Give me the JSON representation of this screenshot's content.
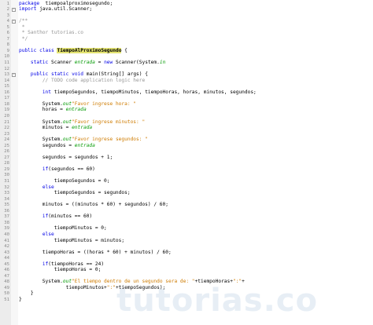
{
  "lines": [
    {
      "n": "1",
      "parts": [
        [
          "kw",
          "package"
        ],
        [
          "",
          "  tiempoalproximosegundo;"
        ]
      ]
    },
    {
      "n": "2",
      "fold": "-",
      "parts": [
        [
          "kw",
          "import"
        ],
        [
          "",
          " java.util.Scanner;"
        ]
      ]
    },
    {
      "n": "3",
      "parts": []
    },
    {
      "n": "4",
      "fold": "-",
      "parts": [
        [
          "com",
          "/**"
        ]
      ]
    },
    {
      "n": "5",
      "parts": [
        [
          "com",
          " *"
        ]
      ]
    },
    {
      "n": "6",
      "parts": [
        [
          "com",
          " * Santhor tutorias.co"
        ]
      ]
    },
    {
      "n": "7",
      "parts": [
        [
          "com",
          " */"
        ]
      ]
    },
    {
      "n": "8",
      "parts": []
    },
    {
      "n": "9",
      "parts": [
        [
          "kw",
          "public"
        ],
        [
          "",
          " "
        ],
        [
          "kw",
          "class"
        ],
        [
          "",
          " "
        ],
        [
          "cls",
          "TiempoAlProximoSegundo"
        ],
        [
          "",
          " {"
        ]
      ]
    },
    {
      "n": "10",
      "parts": []
    },
    {
      "n": "11",
      "parts": [
        [
          "",
          "    "
        ],
        [
          "kw",
          "static"
        ],
        [
          "",
          " Scanner "
        ],
        [
          "fld",
          "entrada"
        ],
        [
          "",
          " = "
        ],
        [
          "kw",
          "new"
        ],
        [
          "",
          " Scanner(System."
        ],
        [
          "fld",
          "in"
        ],
        [
          ");"
        ]
      ]
    },
    {
      "n": "12",
      "parts": []
    },
    {
      "n": "13",
      "fold": "-",
      "parts": [
        [
          "",
          "    "
        ],
        [
          "kw",
          "public"
        ],
        [
          "",
          " "
        ],
        [
          "kw",
          "static"
        ],
        [
          "",
          " "
        ],
        [
          "kw",
          "void"
        ],
        [
          "",
          " main(String[] args) {"
        ]
      ]
    },
    {
      "n": "14",
      "parts": [
        [
          "",
          "        "
        ],
        [
          "com",
          "// TODO code application logic here"
        ]
      ]
    },
    {
      "n": "15",
      "parts": []
    },
    {
      "n": "16",
      "parts": [
        [
          "",
          "        "
        ],
        [
          "kw",
          "int"
        ],
        [
          "",
          " tiempoSegundos, tiempoMinutos, tiempoHoras, horas, minutos, segundos;"
        ]
      ]
    },
    {
      "n": "17",
      "parts": []
    },
    {
      "n": "18",
      "parts": [
        [
          "",
          "        System."
        ],
        [
          "fld",
          "out"
        ],
        [
          ".print("
        ],
        [
          "str",
          "\"Favor ingrese hora: \""
        ],
        [
          ");"
        ]
      ]
    },
    {
      "n": "19",
      "parts": [
        [
          "",
          "        horas = "
        ],
        [
          "fld",
          "entrada"
        ],
        [
          ".nextInt();"
        ]
      ]
    },
    {
      "n": "20",
      "parts": []
    },
    {
      "n": "21",
      "parts": [
        [
          "",
          "        System."
        ],
        [
          "fld",
          "out"
        ],
        [
          ".print("
        ],
        [
          "str",
          "\"Favor ingrese minutos: \""
        ],
        [
          ");"
        ]
      ]
    },
    {
      "n": "22",
      "parts": [
        [
          "",
          "        minutos = "
        ],
        [
          "fld",
          "entrada"
        ],
        [
          ".nextInt();"
        ]
      ]
    },
    {
      "n": "23",
      "parts": []
    },
    {
      "n": "24",
      "parts": [
        [
          "",
          "        System."
        ],
        [
          "fld",
          "out"
        ],
        [
          ".print("
        ],
        [
          "str",
          "\"Favor ingrese segundos: \""
        ],
        [
          ");"
        ]
      ]
    },
    {
      "n": "25",
      "parts": [
        [
          "",
          "        segundos = "
        ],
        [
          "fld",
          "entrada"
        ],
        [
          ".nextInt();"
        ]
      ]
    },
    {
      "n": "26",
      "parts": []
    },
    {
      "n": "27",
      "parts": [
        [
          "",
          "        segundos = segundos + 1;"
        ]
      ]
    },
    {
      "n": "28",
      "parts": []
    },
    {
      "n": "29",
      "parts": [
        [
          "",
          "        "
        ],
        [
          "kw",
          "if"
        ],
        [
          "",
          "(segundos == 60)"
        ]
      ]
    },
    {
      "n": "30",
      "parts": []
    },
    {
      "n": "31",
      "parts": [
        [
          "",
          "            tiempoSegundos = 0;"
        ]
      ]
    },
    {
      "n": "32",
      "parts": [
        [
          "",
          "        "
        ],
        [
          "kw",
          "else"
        ]
      ]
    },
    {
      "n": "33",
      "parts": [
        [
          "",
          "            tiempoSegundos = segundos;"
        ]
      ]
    },
    {
      "n": "34",
      "parts": []
    },
    {
      "n": "35",
      "parts": [
        [
          "",
          "        minutos = ((minutos * 60) + segundos) / 60;"
        ]
      ]
    },
    {
      "n": "36",
      "parts": []
    },
    {
      "n": "37",
      "parts": [
        [
          "",
          "        "
        ],
        [
          "kw",
          "if"
        ],
        [
          "",
          "(minutos == 60)"
        ]
      ]
    },
    {
      "n": "38",
      "parts": []
    },
    {
      "n": "39",
      "parts": [
        [
          "",
          "            tiempoMinutos = 0;"
        ]
      ]
    },
    {
      "n": "40",
      "parts": [
        [
          "",
          "        "
        ],
        [
          "kw",
          "else"
        ]
      ]
    },
    {
      "n": "41",
      "parts": [
        [
          "",
          "            tiempoMinutos = minutos;"
        ]
      ]
    },
    {
      "n": "42",
      "parts": []
    },
    {
      "n": "43",
      "parts": [
        [
          "",
          "        tiempoHoras = ((horas * 60) + minutos) / 60;"
        ]
      ]
    },
    {
      "n": "44",
      "parts": []
    },
    {
      "n": "45",
      "parts": [
        [
          "",
          "        "
        ],
        [
          "kw",
          "if"
        ],
        [
          "",
          "(tiempoHoras == 24)"
        ]
      ]
    },
    {
      "n": "46",
      "parts": [
        [
          "",
          "            tiempoHoras = 0;"
        ]
      ]
    },
    {
      "n": "47",
      "parts": []
    },
    {
      "n": "48",
      "parts": [
        [
          "",
          "        System."
        ],
        [
          "fld",
          "out"
        ],
        [
          ".print("
        ],
        [
          "str",
          "\"El tiempo dentro de un segundo sera de: \""
        ],
        [
          "",
          "+tiempoHoras+"
        ],
        [
          "str",
          "\":\""
        ],
        [
          "",
          "+"
        ]
      ]
    },
    {
      "n": "49",
      "parts": [
        [
          "",
          "                tiempoMinutos+"
        ],
        [
          "str",
          "\":\""
        ],
        [
          "",
          "+tiempoSegundos);"
        ]
      ]
    },
    {
      "n": "50",
      "parts": [
        [
          "",
          "    }"
        ]
      ]
    },
    {
      "n": "51",
      "parts": [
        [
          "",
          "}"
        ]
      ]
    }
  ],
  "watermark": "tutorias.co"
}
